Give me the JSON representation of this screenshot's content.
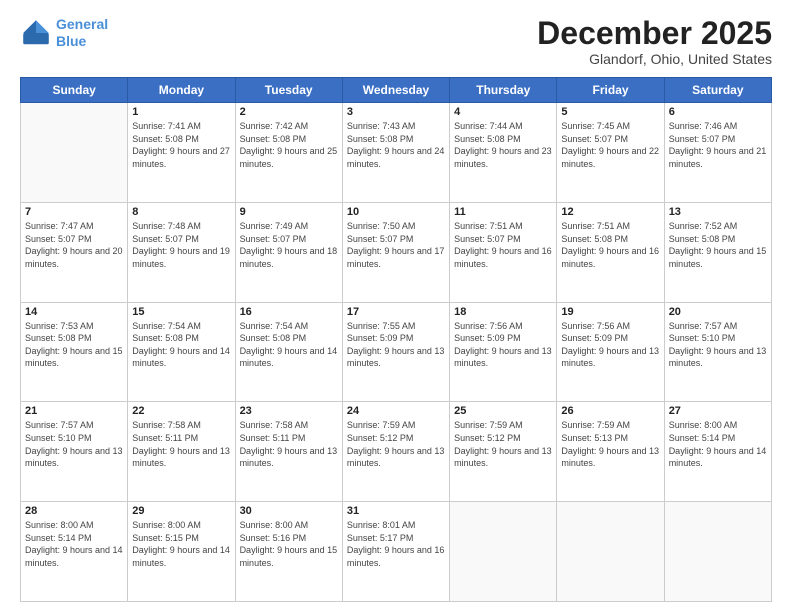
{
  "logo": {
    "line1": "General",
    "line2": "Blue"
  },
  "title": "December 2025",
  "subtitle": "Glandorf, Ohio, United States",
  "weekdays": [
    "Sunday",
    "Monday",
    "Tuesday",
    "Wednesday",
    "Thursday",
    "Friday",
    "Saturday"
  ],
  "weeks": [
    [
      {
        "day": "",
        "empty": true
      },
      {
        "day": "1",
        "sunrise": "7:41 AM",
        "sunset": "5:08 PM",
        "daylight": "9 hours and 27 minutes."
      },
      {
        "day": "2",
        "sunrise": "7:42 AM",
        "sunset": "5:08 PM",
        "daylight": "9 hours and 25 minutes."
      },
      {
        "day": "3",
        "sunrise": "7:43 AM",
        "sunset": "5:08 PM",
        "daylight": "9 hours and 24 minutes."
      },
      {
        "day": "4",
        "sunrise": "7:44 AM",
        "sunset": "5:08 PM",
        "daylight": "9 hours and 23 minutes."
      },
      {
        "day": "5",
        "sunrise": "7:45 AM",
        "sunset": "5:07 PM",
        "daylight": "9 hours and 22 minutes."
      },
      {
        "day": "6",
        "sunrise": "7:46 AM",
        "sunset": "5:07 PM",
        "daylight": "9 hours and 21 minutes."
      }
    ],
    [
      {
        "day": "7",
        "sunrise": "7:47 AM",
        "sunset": "5:07 PM",
        "daylight": "9 hours and 20 minutes."
      },
      {
        "day": "8",
        "sunrise": "7:48 AM",
        "sunset": "5:07 PM",
        "daylight": "9 hours and 19 minutes."
      },
      {
        "day": "9",
        "sunrise": "7:49 AM",
        "sunset": "5:07 PM",
        "daylight": "9 hours and 18 minutes."
      },
      {
        "day": "10",
        "sunrise": "7:50 AM",
        "sunset": "5:07 PM",
        "daylight": "9 hours and 17 minutes."
      },
      {
        "day": "11",
        "sunrise": "7:51 AM",
        "sunset": "5:07 PM",
        "daylight": "9 hours and 16 minutes."
      },
      {
        "day": "12",
        "sunrise": "7:51 AM",
        "sunset": "5:08 PM",
        "daylight": "9 hours and 16 minutes."
      },
      {
        "day": "13",
        "sunrise": "7:52 AM",
        "sunset": "5:08 PM",
        "daylight": "9 hours and 15 minutes."
      }
    ],
    [
      {
        "day": "14",
        "sunrise": "7:53 AM",
        "sunset": "5:08 PM",
        "daylight": "9 hours and 15 minutes."
      },
      {
        "day": "15",
        "sunrise": "7:54 AM",
        "sunset": "5:08 PM",
        "daylight": "9 hours and 14 minutes."
      },
      {
        "day": "16",
        "sunrise": "7:54 AM",
        "sunset": "5:08 PM",
        "daylight": "9 hours and 14 minutes."
      },
      {
        "day": "17",
        "sunrise": "7:55 AM",
        "sunset": "5:09 PM",
        "daylight": "9 hours and 13 minutes."
      },
      {
        "day": "18",
        "sunrise": "7:56 AM",
        "sunset": "5:09 PM",
        "daylight": "9 hours and 13 minutes."
      },
      {
        "day": "19",
        "sunrise": "7:56 AM",
        "sunset": "5:09 PM",
        "daylight": "9 hours and 13 minutes."
      },
      {
        "day": "20",
        "sunrise": "7:57 AM",
        "sunset": "5:10 PM",
        "daylight": "9 hours and 13 minutes."
      }
    ],
    [
      {
        "day": "21",
        "sunrise": "7:57 AM",
        "sunset": "5:10 PM",
        "daylight": "9 hours and 13 minutes."
      },
      {
        "day": "22",
        "sunrise": "7:58 AM",
        "sunset": "5:11 PM",
        "daylight": "9 hours and 13 minutes."
      },
      {
        "day": "23",
        "sunrise": "7:58 AM",
        "sunset": "5:11 PM",
        "daylight": "9 hours and 13 minutes."
      },
      {
        "day": "24",
        "sunrise": "7:59 AM",
        "sunset": "5:12 PM",
        "daylight": "9 hours and 13 minutes."
      },
      {
        "day": "25",
        "sunrise": "7:59 AM",
        "sunset": "5:12 PM",
        "daylight": "9 hours and 13 minutes."
      },
      {
        "day": "26",
        "sunrise": "7:59 AM",
        "sunset": "5:13 PM",
        "daylight": "9 hours and 13 minutes."
      },
      {
        "day": "27",
        "sunrise": "8:00 AM",
        "sunset": "5:14 PM",
        "daylight": "9 hours and 14 minutes."
      }
    ],
    [
      {
        "day": "28",
        "sunrise": "8:00 AM",
        "sunset": "5:14 PM",
        "daylight": "9 hours and 14 minutes."
      },
      {
        "day": "29",
        "sunrise": "8:00 AM",
        "sunset": "5:15 PM",
        "daylight": "9 hours and 14 minutes."
      },
      {
        "day": "30",
        "sunrise": "8:00 AM",
        "sunset": "5:16 PM",
        "daylight": "9 hours and 15 minutes."
      },
      {
        "day": "31",
        "sunrise": "8:01 AM",
        "sunset": "5:17 PM",
        "daylight": "9 hours and 16 minutes."
      },
      {
        "day": "",
        "empty": true
      },
      {
        "day": "",
        "empty": true
      },
      {
        "day": "",
        "empty": true
      }
    ]
  ]
}
